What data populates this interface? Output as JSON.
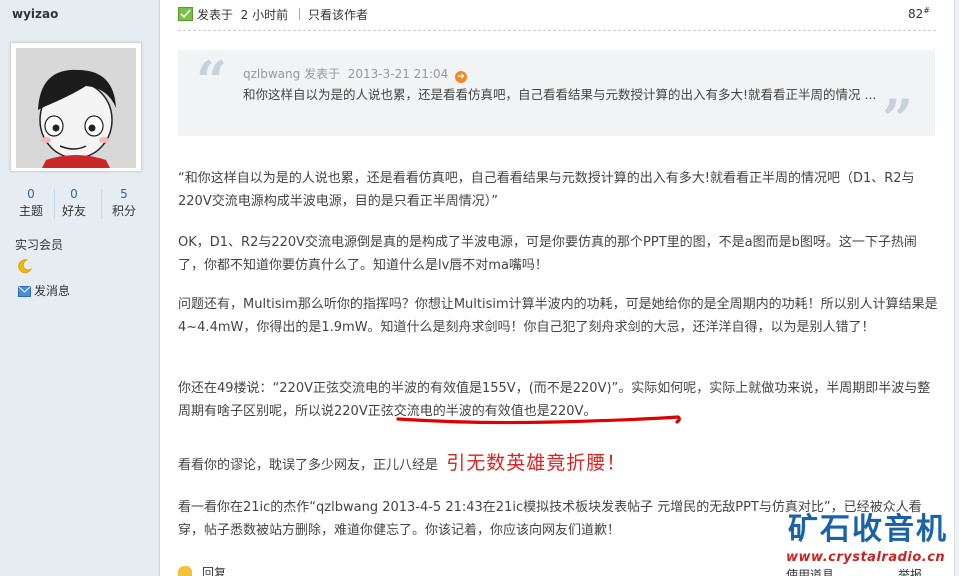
{
  "author": {
    "username": "wyizao",
    "stats": [
      {
        "value": "0",
        "label": "主题"
      },
      {
        "value": "0",
        "label": "好友"
      },
      {
        "value": "5",
        "label": "积分"
      }
    ],
    "rank": "实习会员",
    "rank_icon": "moon-icon",
    "send_message": "发消息"
  },
  "post": {
    "posted_prefix": "发表于",
    "posted_time": "2 小时前",
    "only_author": "只看该作者",
    "floor": "82",
    "floor_mark": "#",
    "quote": {
      "author": "qzlbwang",
      "posted_prefix": "发表于",
      "time": "2013-3-21 21:04",
      "text": "和你这样自以为是的人说也累，还是看看仿真吧，自己看看结果与元数授计算的出入有多大!就看看正半周的情况 ..."
    },
    "paragraphs": {
      "p1": "“和你这样自以为是的人说也累，还是看看仿真吧，自己看看结果与元数授计算的出入有多大!就看看正半周的情况吧（D1、R2与220V交流电源构成半波电源，目的是只看正半周情况）”",
      "p2": "OK，D1、R2与220V交流电源倒是真的是构成了半波电源，可是你要仿真的那个PPT里的图，不是a图而是b图呀。这一下子热闹了，你都不知道你要仿真什么了。知道什么是lv唇不对ma嘴吗！",
      "p3": "问题还有，Multisim那么听你的指挥吗？你想让Multisim计算半波内的功耗，可是她给你的是全周期内的功耗！所以别人计算结果是4~4.4mW，你得出的是1.9mW。知道什么是刻舟求剑吗！你自己犯了刻舟求剑的大忌，还洋洋自得，以为是别人错了！",
      "p4": "你还在49楼说：“220V正弦交流电的半波的有效值是155V，(而不是220V)”。实际如何呢，实际上就做功来说，半周期即半波与整周期有啥子区别呢，所以说220V正弦交流电的半波的有效值也是220V。",
      "p5_lead": "看看你的谬论，耽误了多少网友，正儿八经是",
      "p5_emph": "引无数英雄竟折腰！",
      "p6": "看一看你在21ic的杰作“qzlbwang 2013-4-5 21:43在21ic模拟技术板块发表帖子 元增民的无敌PPT与仿真对比”，已经被众人看穿，帖子悉数被站方删除，难道你健忘了。你该记着，你应该向网友们道歉！"
    },
    "underline_color": "#e00000"
  },
  "footer": {
    "reply": "回复",
    "links": [
      "使用道具",
      "举报"
    ]
  },
  "watermark": {
    "title": "矿石收音机",
    "url": "www.crystalradio.cn"
  },
  "colors": {
    "sidebar_bg": "#e5edf2",
    "quote_bg": "#f1f3f4",
    "link": "#336699",
    "emphasis": "#dd2222"
  }
}
